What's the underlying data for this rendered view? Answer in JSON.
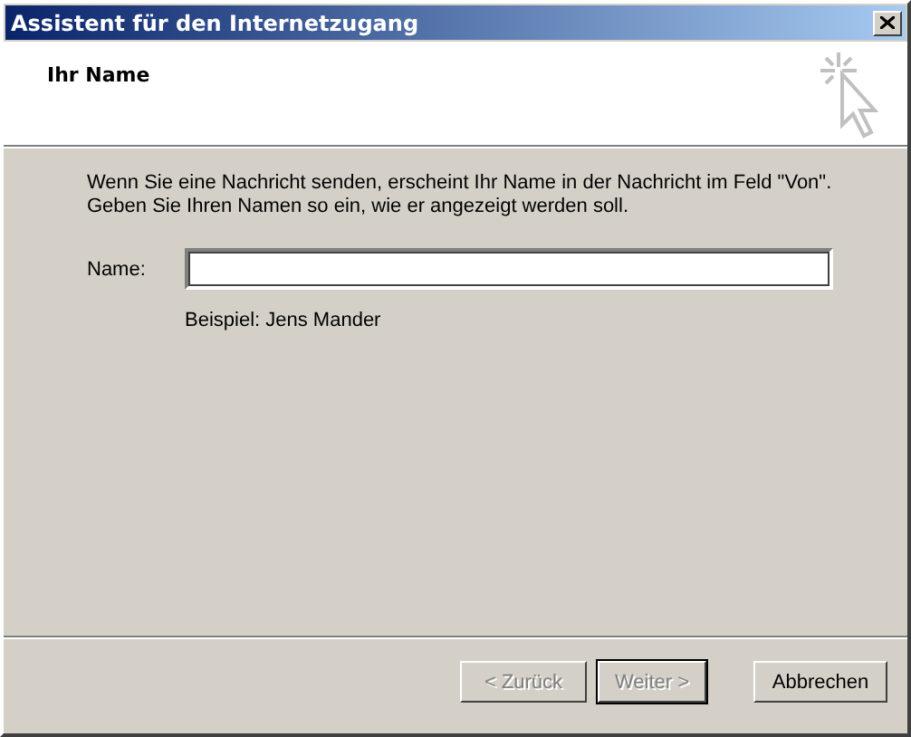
{
  "window": {
    "title": "Assistent für den Internetzugang"
  },
  "header": {
    "title": "Ihr Name"
  },
  "intro": [
    "Wenn Sie eine Nachricht senden, erscheint Ihr Name in der Nachricht im Feld \"Von\".",
    "Geben Sie Ihren Namen so ein, wie er angezeigt werden soll."
  ],
  "name_field": {
    "label": "Name:"
  },
  "example": "Beispiel: Jens Mander",
  "buttons": [
    {
      "label": "< Zurück",
      "disabled": true,
      "default": false
    },
    {
      "label": "Weiter >",
      "disabled": true,
      "default": true
    },
    {
      "label": "Abbrechen",
      "disabled": false,
      "default": false
    }
  ]
}
